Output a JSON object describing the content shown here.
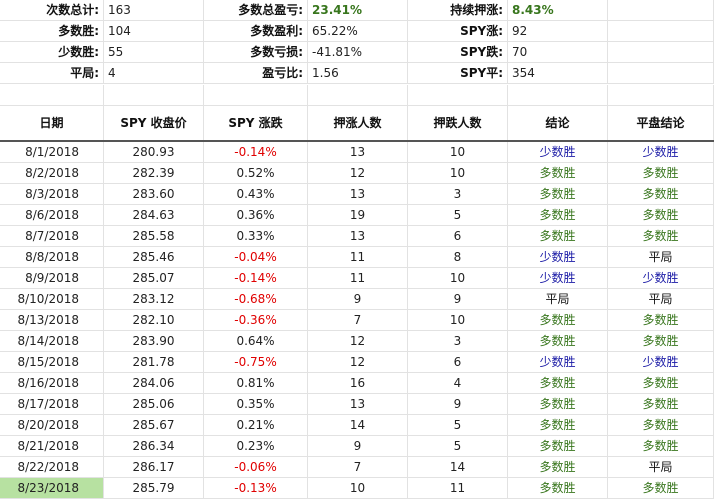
{
  "summary": [
    {
      "l1": "次数总计:",
      "v1": "163",
      "l2": "多数总盈亏:",
      "v2": "23.41%",
      "v2green": true,
      "l3": "持续押涨:",
      "v3": "8.43%",
      "v3green": true
    },
    {
      "l1": "多数胜:",
      "v1": "104",
      "l2": "多数盈利:",
      "v2": "65.22%",
      "v2green": false,
      "l3": "SPY涨:",
      "v3": "92",
      "v3green": false
    },
    {
      "l1": "少数胜:",
      "v1": "55",
      "l2": "多数亏损:",
      "v2": "-41.81%",
      "v2green": false,
      "l3": "SPY跌:",
      "v3": "70",
      "v3green": false
    },
    {
      "l1": "平局:",
      "v1": "4",
      "l2": "盈亏比:",
      "v2": "1.56",
      "v2green": false,
      "l3": "SPY平:",
      "v3": "354",
      "v3green": false
    }
  ],
  "headers": [
    "日期",
    "SPY 收盘价",
    "SPY 涨跌",
    "押涨人数",
    "押跌人数",
    "结论",
    "平盘结论"
  ],
  "rows": [
    [
      "8/1/2018",
      "280.93",
      "-0.14%",
      "13",
      "10",
      "少数胜",
      "少数胜"
    ],
    [
      "8/2/2018",
      "282.39",
      "0.52%",
      "12",
      "10",
      "多数胜",
      "多数胜"
    ],
    [
      "8/3/2018",
      "283.60",
      "0.43%",
      "13",
      "3",
      "多数胜",
      "多数胜"
    ],
    [
      "8/6/2018",
      "284.63",
      "0.36%",
      "19",
      "5",
      "多数胜",
      "多数胜"
    ],
    [
      "8/7/2018",
      "285.58",
      "0.33%",
      "13",
      "6",
      "多数胜",
      "多数胜"
    ],
    [
      "8/8/2018",
      "285.46",
      "-0.04%",
      "11",
      "8",
      "少数胜",
      "平局"
    ],
    [
      "8/9/2018",
      "285.07",
      "-0.14%",
      "11",
      "10",
      "少数胜",
      "少数胜"
    ],
    [
      "8/10/2018",
      "283.12",
      "-0.68%",
      "9",
      "9",
      "平局",
      "平局"
    ],
    [
      "8/13/2018",
      "282.10",
      "-0.36%",
      "7",
      "10",
      "多数胜",
      "多数胜"
    ],
    [
      "8/14/2018",
      "283.90",
      "0.64%",
      "12",
      "3",
      "多数胜",
      "多数胜"
    ],
    [
      "8/15/2018",
      "281.78",
      "-0.75%",
      "12",
      "6",
      "少数胜",
      "少数胜"
    ],
    [
      "8/16/2018",
      "284.06",
      "0.81%",
      "16",
      "4",
      "多数胜",
      "多数胜"
    ],
    [
      "8/17/2018",
      "285.06",
      "0.35%",
      "13",
      "9",
      "多数胜",
      "多数胜"
    ],
    [
      "8/20/2018",
      "285.67",
      "0.21%",
      "14",
      "5",
      "多数胜",
      "多数胜"
    ],
    [
      "8/21/2018",
      "286.34",
      "0.23%",
      "9",
      "5",
      "多数胜",
      "多数胜"
    ],
    [
      "8/22/2018",
      "286.17",
      "-0.06%",
      "7",
      "14",
      "多数胜",
      "平局"
    ],
    [
      "8/23/2018",
      "285.79",
      "-0.13%",
      "10",
      "11",
      "多数胜",
      "多数胜"
    ]
  ],
  "selected_row": 16,
  "colors": {
    "negative": "#e00000",
    "minority": "#1a1aa6",
    "majority": "#38761d",
    "selected": "#b7e1a1"
  }
}
